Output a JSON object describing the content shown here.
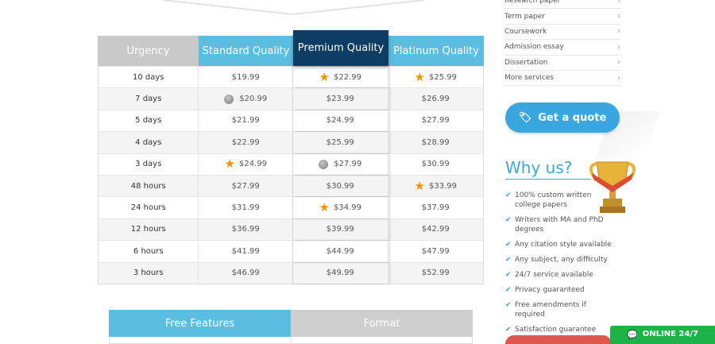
{
  "price_table": {
    "headers": {
      "urgency": "Urgency",
      "standard": "Standard Quality",
      "premium": "Premium Quality",
      "platinum": "Platinum Quality"
    },
    "rows": [
      {
        "urgency": "10 days",
        "standard": "$19.99",
        "premium": "$22.99",
        "platinum": "$25.99",
        "marks": {
          "premium": "star",
          "platinum": "star"
        }
      },
      {
        "urgency": "7 days",
        "standard": "$20.99",
        "premium": "$23.99",
        "platinum": "$26.99",
        "marks": {
          "standard": "badge"
        }
      },
      {
        "urgency": "5 days",
        "standard": "$21.99",
        "premium": "$24.99",
        "platinum": "$27.99",
        "marks": {}
      },
      {
        "urgency": "4 days",
        "standard": "$22.99",
        "premium": "$25.99",
        "platinum": "$28.99",
        "marks": {}
      },
      {
        "urgency": "3 days",
        "standard": "$24.99",
        "premium": "$27.99",
        "platinum": "$30.99",
        "marks": {
          "standard": "star",
          "premium": "badge"
        }
      },
      {
        "urgency": "48 hours",
        "standard": "$27.99",
        "premium": "$30.99",
        "platinum": "$33.99",
        "marks": {
          "platinum": "star"
        }
      },
      {
        "urgency": "24 hours",
        "standard": "$31.99",
        "premium": "$34.99",
        "platinum": "$37.99",
        "marks": {
          "premium": "star"
        }
      },
      {
        "urgency": "12 hours",
        "standard": "$36.99",
        "premium": "$39.99",
        "platinum": "$42.99",
        "marks": {}
      },
      {
        "urgency": "6 hours",
        "standard": "$41.99",
        "premium": "$44.99",
        "platinum": "$47.99",
        "marks": {}
      },
      {
        "urgency": "3 hours",
        "standard": "$46.99",
        "premium": "$49.99",
        "platinum": "$52.99",
        "marks": {}
      }
    ]
  },
  "features": {
    "free_label": "Free Features",
    "format_label": "Format"
  },
  "services": [
    {
      "label": "Research paper"
    },
    {
      "label": "Term paper"
    },
    {
      "label": "Coursework"
    },
    {
      "label": "Admission essay"
    },
    {
      "label": "Dissertation"
    },
    {
      "label": "More services"
    }
  ],
  "quote_button": {
    "label": "Get a quote",
    "icon": "tag-icon"
  },
  "why_us": {
    "title": "Why us?",
    "items": [
      "100% custom written college papers",
      "Writers with MA and PhD degrees",
      "Any citation style available",
      "Any subject, any difficulty",
      "24/7 service available",
      "Privacy guaranteed",
      "Free amendments if required",
      "Satisfaction guarantee"
    ]
  },
  "online_chat": {
    "label": "ONLINE 24/7",
    "icon": "chat-icon"
  },
  "colors": {
    "accent_blue": "#5bbde0",
    "premium_navy": "#0e3d63",
    "star_orange": "#f39200",
    "online_green": "#1db34a"
  }
}
